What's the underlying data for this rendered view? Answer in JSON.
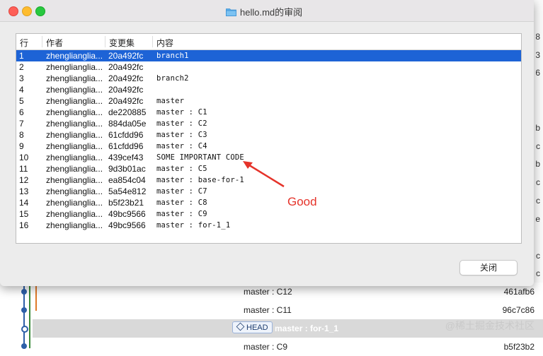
{
  "window": {
    "title": "hello.md的审阅",
    "folder_icon": "folder-icon"
  },
  "table": {
    "headers": {
      "line": "行",
      "author": "作者",
      "changeset": "变更集",
      "content": "内容"
    },
    "rows": [
      {
        "line": "1",
        "author": "zhengliangliа...",
        "changeset": "20a492fc",
        "content": "branch1",
        "selected": true
      },
      {
        "line": "2",
        "author": "zhengliangliа...",
        "changeset": "20a492fc",
        "content": ""
      },
      {
        "line": "3",
        "author": "zhengliangliа...",
        "changeset": "20a492fc",
        "content": "branch2"
      },
      {
        "line": "4",
        "author": "zhengliangliа...",
        "changeset": "20a492fc",
        "content": ""
      },
      {
        "line": "5",
        "author": "zhengliangliа...",
        "changeset": "20a492fc",
        "content": "master"
      },
      {
        "line": "6",
        "author": "zhengliangliа...",
        "changeset": "de220885",
        "content": "master : C1"
      },
      {
        "line": "7",
        "author": "zhengliangliа...",
        "changeset": "884da05e",
        "content": "master : C2"
      },
      {
        "line": "8",
        "author": "zhengliangliа...",
        "changeset": "61cfdd96",
        "content": "master : C3"
      },
      {
        "line": "9",
        "author": "zhengliangliа...",
        "changeset": "61cfdd96",
        "content": "master : C4"
      },
      {
        "line": "10",
        "author": "zhengliangliа...",
        "changeset": "439cef43",
        "content": "SOME IMPORTANT CODE"
      },
      {
        "line": "11",
        "author": "zhengliangliа...",
        "changeset": "9d3b01ac",
        "content": "master : C5"
      },
      {
        "line": "12",
        "author": "zhengliangliа...",
        "changeset": "ea854c04",
        "content": "master : base-for-1"
      },
      {
        "line": "13",
        "author": "zhengliangliа...",
        "changeset": "5a54e812",
        "content": "master : C7"
      },
      {
        "line": "14",
        "author": "zhengliangliа...",
        "changeset": "b5f23b21",
        "content": "master : C8"
      },
      {
        "line": "15",
        "author": "zhengliangliа...",
        "changeset": "49bc9566",
        "content": "master : C9"
      },
      {
        "line": "16",
        "author": "zhengliangliа...",
        "changeset": "49bc9566",
        "content": "master : for-1_1"
      }
    ]
  },
  "annotation": {
    "text": "Good",
    "color": "#e5332a"
  },
  "buttons": {
    "close_label": "关闭"
  },
  "background_log": {
    "rows": [
      {
        "message": "master : C12",
        "hash": "461afb6"
      },
      {
        "message": "master : C11",
        "hash": "96c7c86"
      },
      {
        "tag": "HEAD",
        "message": "master : for-1_1",
        "hash": ""
      },
      {
        "message": "master : C9",
        "hash": "b5f23b2"
      }
    ],
    "edge_fragments": [
      "8",
      "3",
      "6",
      "b",
      "c",
      "b",
      "c",
      "c",
      "e",
      "c",
      "c"
    ]
  },
  "watermark": "@稀土掘金技术社区",
  "colors": {
    "selection": "#1d63d6",
    "graph_blue": "#2d5fa8",
    "graph_green": "#3a8a3a",
    "graph_orange": "#e07a2a"
  }
}
